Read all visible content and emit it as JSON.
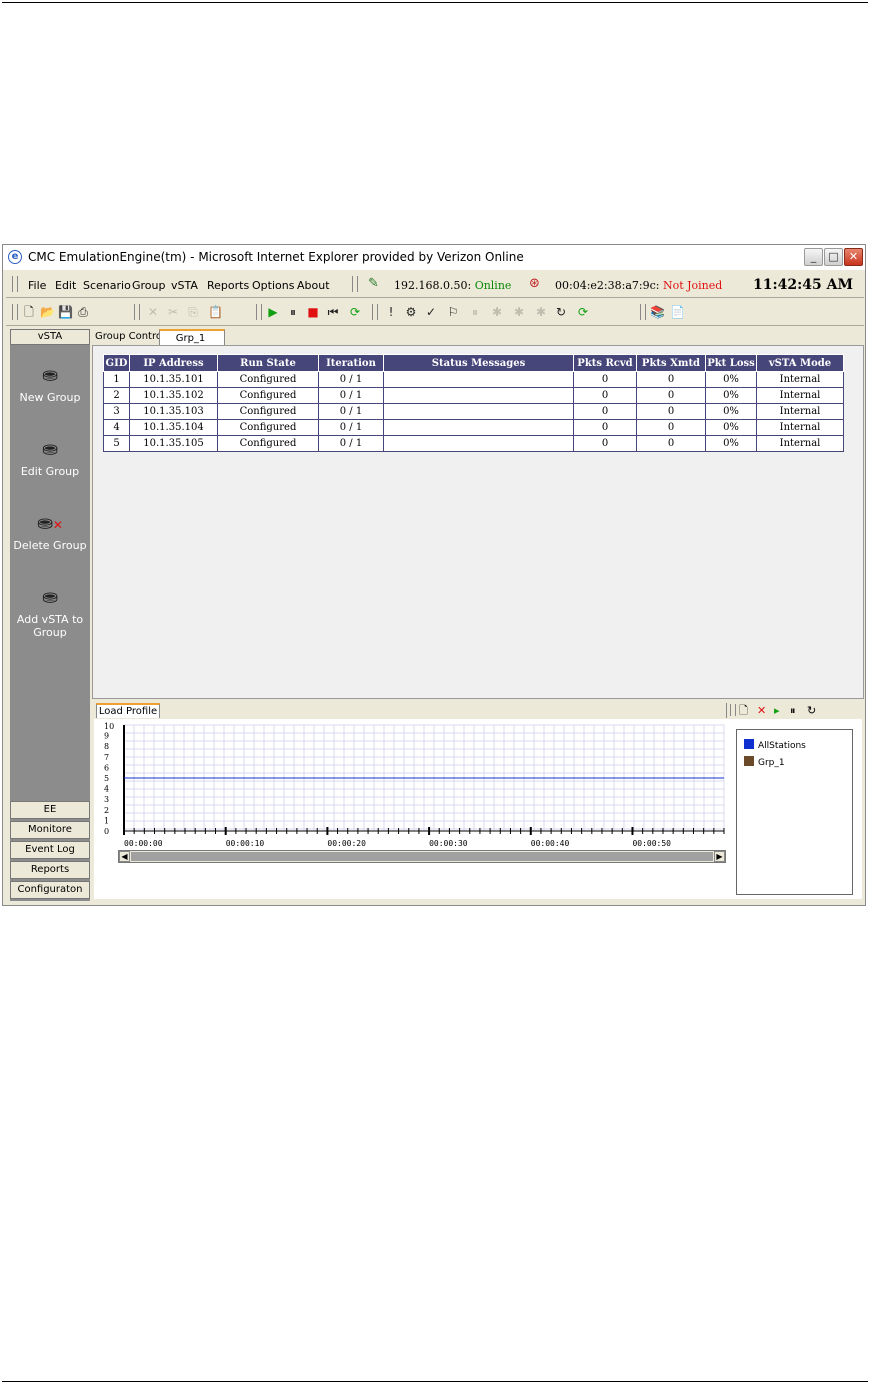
{
  "window": {
    "title": "CMC EmulationEngine(tm) - Microsoft Internet Explorer provided by Verizon Online",
    "controls": [
      "_",
      "□",
      "✕"
    ]
  },
  "menu": [
    "File",
    "Edit",
    "Scenario",
    "Group",
    "vSTA",
    "Reports",
    "Options",
    "About"
  ],
  "status": {
    "ip": "192.168.0.50:",
    "ip_state": "Online",
    "mac": "00:04:e2:38:a7:9c:",
    "mac_state": "Not Joined",
    "clock": "11:42:45 AM"
  },
  "sidebar": {
    "header": "vSTA",
    "actions": [
      {
        "label": "New Group",
        "icon": "new-group-icon"
      },
      {
        "label": "Edit Group",
        "icon": "edit-group-icon"
      },
      {
        "label": "Delete Group",
        "icon": "delete-group-icon"
      },
      {
        "label": "Add vSTA to Group",
        "icon": "add-vsta-icon"
      }
    ],
    "nav": [
      "EE",
      "Monitore",
      "Event Log",
      "Reports",
      "Configuraton"
    ]
  },
  "tabs": [
    "Group Control",
    "Grp_1"
  ],
  "table": {
    "headers": [
      "GID",
      "IP Address",
      "Run State",
      "Iteration",
      "Status Messages",
      "Pkts Rcvd",
      "Pkts Xmtd",
      "Pkt Loss",
      "vSTA Mode"
    ],
    "rows": [
      [
        "1",
        "10.1.35.101",
        "Configured",
        "0 / 1",
        "",
        "0",
        "0",
        "0%",
        "Internal"
      ],
      [
        "2",
        "10.1.35.102",
        "Configured",
        "0 / 1",
        "",
        "0",
        "0",
        "0%",
        "Internal"
      ],
      [
        "3",
        "10.1.35.103",
        "Configured",
        "0 / 1",
        "",
        "0",
        "0",
        "0%",
        "Internal"
      ],
      [
        "4",
        "10.1.35.104",
        "Configured",
        "0 / 1",
        "",
        "0",
        "0",
        "0%",
        "Internal"
      ],
      [
        "5",
        "10.1.35.105",
        "Configured",
        "0 / 1",
        "",
        "0",
        "0",
        "0%",
        "Internal"
      ]
    ]
  },
  "load_profile": {
    "tab_label": "Load Profile",
    "legend": [
      {
        "name": "AllStations",
        "color": "#1030d0"
      },
      {
        "name": "Grp_1",
        "color": "#6b4a2a"
      }
    ]
  },
  "chart_data": {
    "type": "line",
    "title": "",
    "xlabel": "",
    "ylabel": "",
    "ylim": [
      0,
      10
    ],
    "yticks": [
      "10",
      "9",
      "8",
      "7",
      "6",
      "5",
      "4",
      "3",
      "2",
      "1",
      "0"
    ],
    "xticks": [
      "00:00:00",
      "00:00:10",
      "00:00:20",
      "00:00:30",
      "00:00:40",
      "00:00:50"
    ],
    "xlim": [
      0,
      59
    ],
    "series": [
      {
        "name": "AllStations",
        "x": [
          0,
          59
        ],
        "values": [
          5,
          5
        ]
      }
    ]
  }
}
